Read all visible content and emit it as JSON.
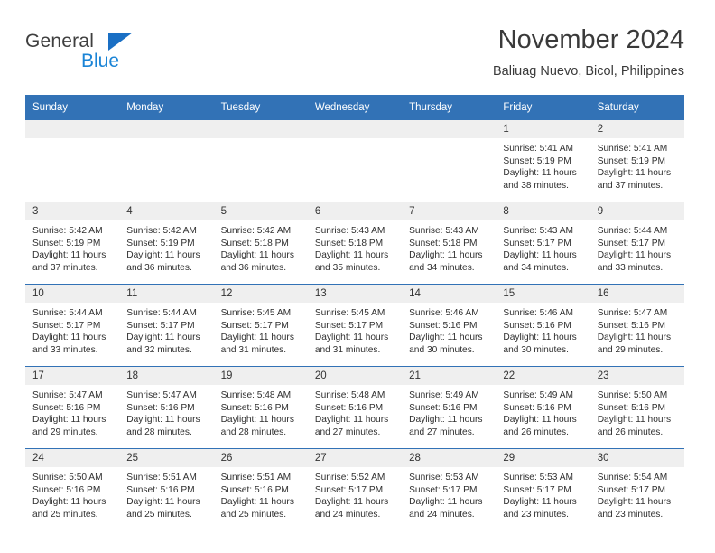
{
  "brand": {
    "name_part1": "General",
    "name_part2": "Blue",
    "triangle_icon": "triangle-icon",
    "accent_color": "#1a84d6"
  },
  "header": {
    "title": "November 2024",
    "subtitle": "Baliuag Nuevo, Bicol, Philippines"
  },
  "theme": {
    "header_blue": "#3272b6",
    "daynum_band": "#efefef",
    "text": "#2f2f2f"
  },
  "weekday_headers": [
    "Sunday",
    "Monday",
    "Tuesday",
    "Wednesday",
    "Thursday",
    "Friday",
    "Saturday"
  ],
  "weeks": [
    [
      {
        "day": "",
        "sunrise": "",
        "sunset": "",
        "daylight_line1": "",
        "daylight_line2": "",
        "empty": true
      },
      {
        "day": "",
        "sunrise": "",
        "sunset": "",
        "daylight_line1": "",
        "daylight_line2": "",
        "empty": true
      },
      {
        "day": "",
        "sunrise": "",
        "sunset": "",
        "daylight_line1": "",
        "daylight_line2": "",
        "empty": true
      },
      {
        "day": "",
        "sunrise": "",
        "sunset": "",
        "daylight_line1": "",
        "daylight_line2": "",
        "empty": true
      },
      {
        "day": "",
        "sunrise": "",
        "sunset": "",
        "daylight_line1": "",
        "daylight_line2": "",
        "empty": true
      },
      {
        "day": "1",
        "sunrise": "Sunrise: 5:41 AM",
        "sunset": "Sunset: 5:19 PM",
        "daylight_line1": "Daylight: 11 hours",
        "daylight_line2": "and 38 minutes.",
        "empty": false
      },
      {
        "day": "2",
        "sunrise": "Sunrise: 5:41 AM",
        "sunset": "Sunset: 5:19 PM",
        "daylight_line1": "Daylight: 11 hours",
        "daylight_line2": "and 37 minutes.",
        "empty": false
      }
    ],
    [
      {
        "day": "3",
        "sunrise": "Sunrise: 5:42 AM",
        "sunset": "Sunset: 5:19 PM",
        "daylight_line1": "Daylight: 11 hours",
        "daylight_line2": "and 37 minutes.",
        "empty": false
      },
      {
        "day": "4",
        "sunrise": "Sunrise: 5:42 AM",
        "sunset": "Sunset: 5:19 PM",
        "daylight_line1": "Daylight: 11 hours",
        "daylight_line2": "and 36 minutes.",
        "empty": false
      },
      {
        "day": "5",
        "sunrise": "Sunrise: 5:42 AM",
        "sunset": "Sunset: 5:18 PM",
        "daylight_line1": "Daylight: 11 hours",
        "daylight_line2": "and 36 minutes.",
        "empty": false
      },
      {
        "day": "6",
        "sunrise": "Sunrise: 5:43 AM",
        "sunset": "Sunset: 5:18 PM",
        "daylight_line1": "Daylight: 11 hours",
        "daylight_line2": "and 35 minutes.",
        "empty": false
      },
      {
        "day": "7",
        "sunrise": "Sunrise: 5:43 AM",
        "sunset": "Sunset: 5:18 PM",
        "daylight_line1": "Daylight: 11 hours",
        "daylight_line2": "and 34 minutes.",
        "empty": false
      },
      {
        "day": "8",
        "sunrise": "Sunrise: 5:43 AM",
        "sunset": "Sunset: 5:17 PM",
        "daylight_line1": "Daylight: 11 hours",
        "daylight_line2": "and 34 minutes.",
        "empty": false
      },
      {
        "day": "9",
        "sunrise": "Sunrise: 5:44 AM",
        "sunset": "Sunset: 5:17 PM",
        "daylight_line1": "Daylight: 11 hours",
        "daylight_line2": "and 33 minutes.",
        "empty": false
      }
    ],
    [
      {
        "day": "10",
        "sunrise": "Sunrise: 5:44 AM",
        "sunset": "Sunset: 5:17 PM",
        "daylight_line1": "Daylight: 11 hours",
        "daylight_line2": "and 33 minutes.",
        "empty": false
      },
      {
        "day": "11",
        "sunrise": "Sunrise: 5:44 AM",
        "sunset": "Sunset: 5:17 PM",
        "daylight_line1": "Daylight: 11 hours",
        "daylight_line2": "and 32 minutes.",
        "empty": false
      },
      {
        "day": "12",
        "sunrise": "Sunrise: 5:45 AM",
        "sunset": "Sunset: 5:17 PM",
        "daylight_line1": "Daylight: 11 hours",
        "daylight_line2": "and 31 minutes.",
        "empty": false
      },
      {
        "day": "13",
        "sunrise": "Sunrise: 5:45 AM",
        "sunset": "Sunset: 5:17 PM",
        "daylight_line1": "Daylight: 11 hours",
        "daylight_line2": "and 31 minutes.",
        "empty": false
      },
      {
        "day": "14",
        "sunrise": "Sunrise: 5:46 AM",
        "sunset": "Sunset: 5:16 PM",
        "daylight_line1": "Daylight: 11 hours",
        "daylight_line2": "and 30 minutes.",
        "empty": false
      },
      {
        "day": "15",
        "sunrise": "Sunrise: 5:46 AM",
        "sunset": "Sunset: 5:16 PM",
        "daylight_line1": "Daylight: 11 hours",
        "daylight_line2": "and 30 minutes.",
        "empty": false
      },
      {
        "day": "16",
        "sunrise": "Sunrise: 5:47 AM",
        "sunset": "Sunset: 5:16 PM",
        "daylight_line1": "Daylight: 11 hours",
        "daylight_line2": "and 29 minutes.",
        "empty": false
      }
    ],
    [
      {
        "day": "17",
        "sunrise": "Sunrise: 5:47 AM",
        "sunset": "Sunset: 5:16 PM",
        "daylight_line1": "Daylight: 11 hours",
        "daylight_line2": "and 29 minutes.",
        "empty": false
      },
      {
        "day": "18",
        "sunrise": "Sunrise: 5:47 AM",
        "sunset": "Sunset: 5:16 PM",
        "daylight_line1": "Daylight: 11 hours",
        "daylight_line2": "and 28 minutes.",
        "empty": false
      },
      {
        "day": "19",
        "sunrise": "Sunrise: 5:48 AM",
        "sunset": "Sunset: 5:16 PM",
        "daylight_line1": "Daylight: 11 hours",
        "daylight_line2": "and 28 minutes.",
        "empty": false
      },
      {
        "day": "20",
        "sunrise": "Sunrise: 5:48 AM",
        "sunset": "Sunset: 5:16 PM",
        "daylight_line1": "Daylight: 11 hours",
        "daylight_line2": "and 27 minutes.",
        "empty": false
      },
      {
        "day": "21",
        "sunrise": "Sunrise: 5:49 AM",
        "sunset": "Sunset: 5:16 PM",
        "daylight_line1": "Daylight: 11 hours",
        "daylight_line2": "and 27 minutes.",
        "empty": false
      },
      {
        "day": "22",
        "sunrise": "Sunrise: 5:49 AM",
        "sunset": "Sunset: 5:16 PM",
        "daylight_line1": "Daylight: 11 hours",
        "daylight_line2": "and 26 minutes.",
        "empty": false
      },
      {
        "day": "23",
        "sunrise": "Sunrise: 5:50 AM",
        "sunset": "Sunset: 5:16 PM",
        "daylight_line1": "Daylight: 11 hours",
        "daylight_line2": "and 26 minutes.",
        "empty": false
      }
    ],
    [
      {
        "day": "24",
        "sunrise": "Sunrise: 5:50 AM",
        "sunset": "Sunset: 5:16 PM",
        "daylight_line1": "Daylight: 11 hours",
        "daylight_line2": "and 25 minutes.",
        "empty": false
      },
      {
        "day": "25",
        "sunrise": "Sunrise: 5:51 AM",
        "sunset": "Sunset: 5:16 PM",
        "daylight_line1": "Daylight: 11 hours",
        "daylight_line2": "and 25 minutes.",
        "empty": false
      },
      {
        "day": "26",
        "sunrise": "Sunrise: 5:51 AM",
        "sunset": "Sunset: 5:16 PM",
        "daylight_line1": "Daylight: 11 hours",
        "daylight_line2": "and 25 minutes.",
        "empty": false
      },
      {
        "day": "27",
        "sunrise": "Sunrise: 5:52 AM",
        "sunset": "Sunset: 5:17 PM",
        "daylight_line1": "Daylight: 11 hours",
        "daylight_line2": "and 24 minutes.",
        "empty": false
      },
      {
        "day": "28",
        "sunrise": "Sunrise: 5:53 AM",
        "sunset": "Sunset: 5:17 PM",
        "daylight_line1": "Daylight: 11 hours",
        "daylight_line2": "and 24 minutes.",
        "empty": false
      },
      {
        "day": "29",
        "sunrise": "Sunrise: 5:53 AM",
        "sunset": "Sunset: 5:17 PM",
        "daylight_line1": "Daylight: 11 hours",
        "daylight_line2": "and 23 minutes.",
        "empty": false
      },
      {
        "day": "30",
        "sunrise": "Sunrise: 5:54 AM",
        "sunset": "Sunset: 5:17 PM",
        "daylight_line1": "Daylight: 11 hours",
        "daylight_line2": "and 23 minutes.",
        "empty": false
      }
    ]
  ]
}
